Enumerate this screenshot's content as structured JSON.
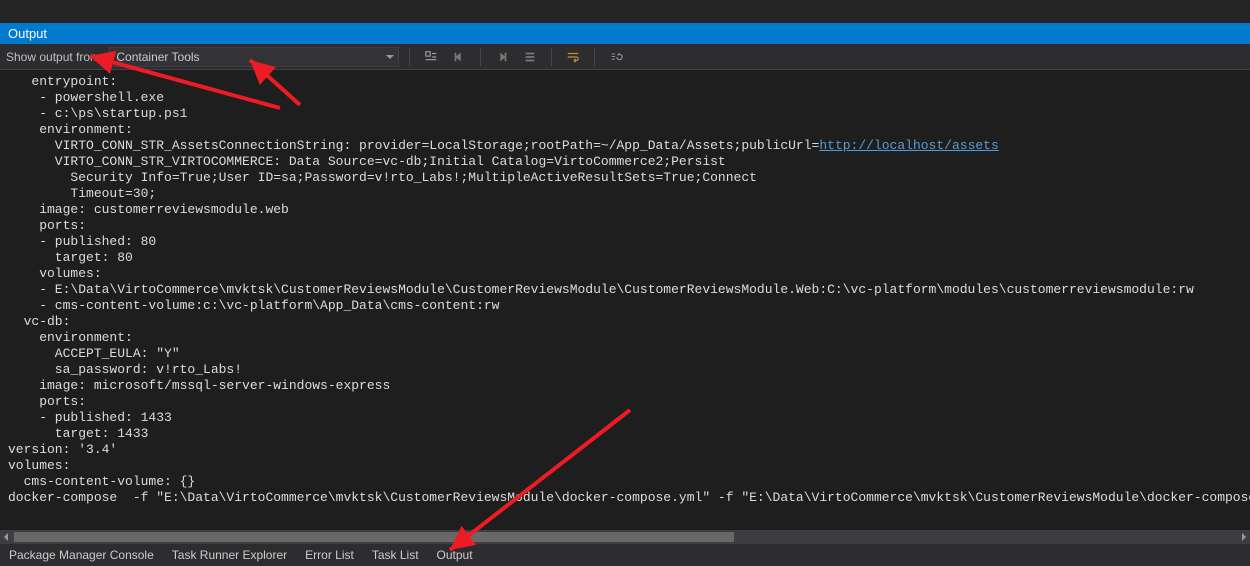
{
  "panel": {
    "title": "Output"
  },
  "toolbar": {
    "show_label": "Show output from:",
    "source_selected": "Container Tools"
  },
  "output": {
    "pre1": "   entrypoint:\n    - powershell.exe\n    - c:\\ps\\startup.ps1\n    environment:\n      VIRTO_CONN_STR_AssetsConnectionString: provider=LocalStorage;rootPath=~/App_Data/Assets;publicUrl=",
    "link_text": "http://localhost/assets",
    "pre2": "\n      VIRTO_CONN_STR_VIRTOCOMMERCE: Data Source=vc-db;Initial Catalog=VirtoCommerce2;Persist\n        Security Info=True;User ID=sa;Password=v!rto_Labs!;MultipleActiveResultSets=True;Connect\n        Timeout=30;\n    image: customerreviewsmodule.web\n    ports:\n    - published: 80\n      target: 80\n    volumes:\n    - E:\\Data\\VirtoCommerce\\mvktsk\\CustomerReviewsModule\\CustomerReviewsModule\\CustomerReviewsModule.Web:C:\\vc-platform\\modules\\customerreviewsmodule:rw\n    - cms-content-volume:c:\\vc-platform\\App_Data\\cms-content:rw\n  vc-db:\n    environment:\n      ACCEPT_EULA: \"Y\"\n      sa_password: v!rto_Labs!\n    image: microsoft/mssql-server-windows-express\n    ports:\n    - published: 1433\n      target: 1433\nversion: '3.4'\nvolumes:\n  cms-content-volume: {}\ndocker-compose  -f \"E:\\Data\\VirtoCommerce\\mvktsk\\CustomerReviewsModule\\docker-compose.yml\" -f \"E:\\Data\\VirtoCommerce\\mvktsk\\CustomerReviewsModule\\docker-compose.override.yml\" -f \"E:\\Data\\VirtoC"
  },
  "bottom_tabs": {
    "pkg": "Package Manager Console",
    "task_runner": "Task Runner Explorer",
    "error_list": "Error List",
    "task_list": "Task List",
    "output": "Output"
  },
  "annotations": {
    "accent": "#ed1c24"
  }
}
